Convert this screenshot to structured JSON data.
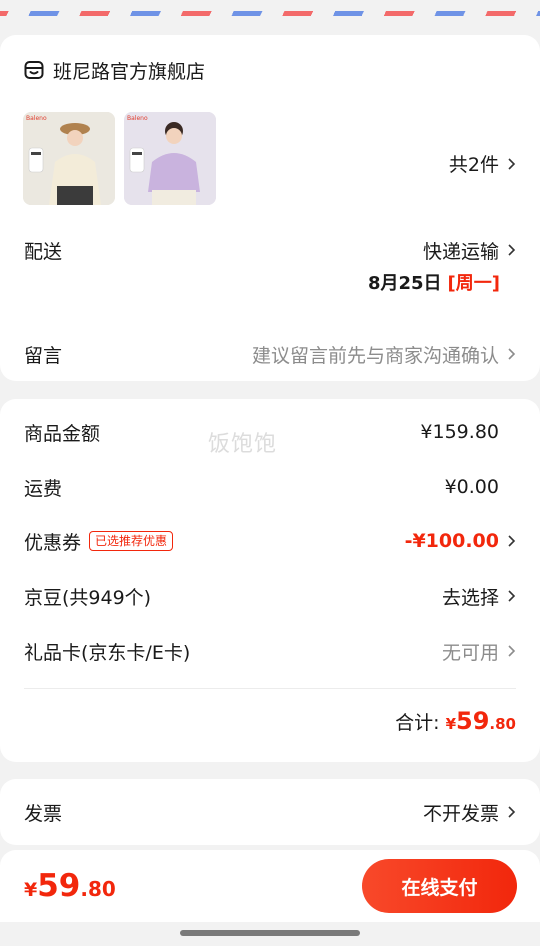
{
  "store": {
    "name": "班尼路官方旗舰店",
    "icon": "store-icon"
  },
  "products": {
    "count_label": "共2件",
    "items": [
      {
        "brand_text": "Baleno",
        "color": "#f3ecd9"
      },
      {
        "brand_text": "Baleno",
        "color": "#c9b3de"
      }
    ]
  },
  "delivery": {
    "label": "配送",
    "method": "快递运输",
    "date": "8月25日",
    "weekday": "[周一]"
  },
  "note": {
    "label": "留言",
    "placeholder": "建议留言前先与商家沟通确认"
  },
  "amounts": {
    "goods": {
      "label": "商品金额",
      "value": "¥159.80"
    },
    "shipping": {
      "label": "运费",
      "value": "¥0.00"
    },
    "coupon": {
      "label": "优惠券",
      "badge": "已选推荐优惠",
      "value": "-¥100.00"
    },
    "jd_beans": {
      "label": "京豆(共949个)",
      "value": "去选择"
    },
    "gift_card": {
      "label": "礼品卡(京东卡/E卡)",
      "value": "无可用"
    },
    "total": {
      "label": "合计:",
      "symbol": "¥",
      "integer": "59",
      "decimal": ".80"
    }
  },
  "watermark": "饭饱饱",
  "invoice": {
    "label": "发票",
    "value": "不开发票"
  },
  "bottom_bar": {
    "symbol": "¥",
    "integer": "59",
    "decimal": ".80",
    "pay_label": "在线支付"
  },
  "colors": {
    "accent": "#f2270c",
    "background": "#f2f2f2",
    "text": "#1a1a1a",
    "muted": "#8c8c8c"
  }
}
